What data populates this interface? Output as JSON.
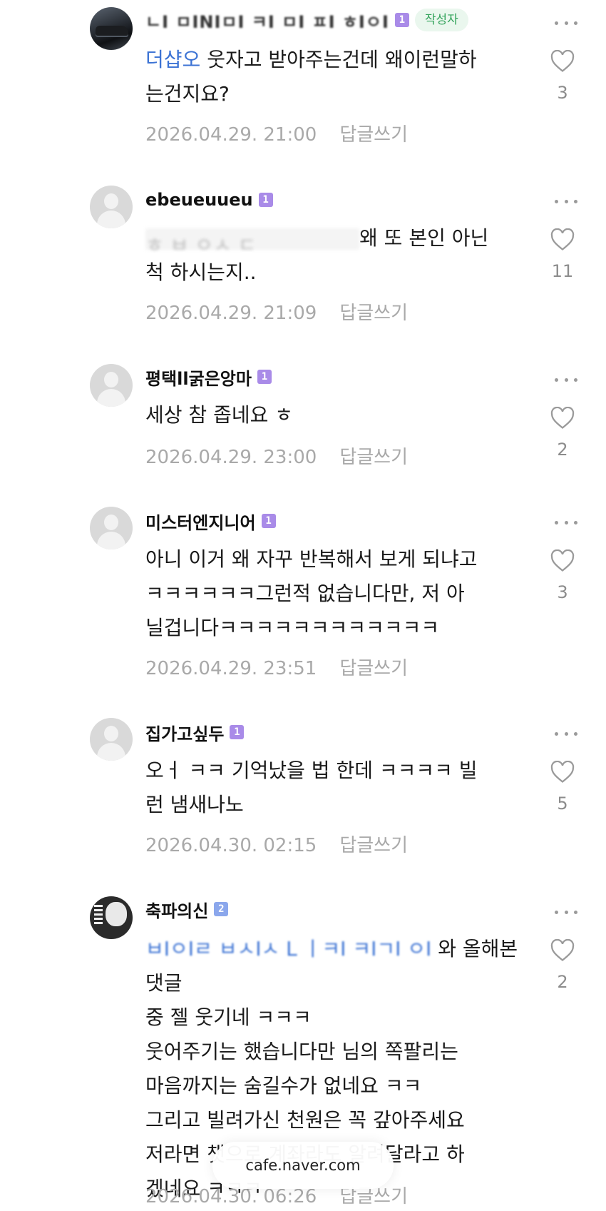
{
  "comments": [
    {
      "nickname": "ㄴI ㅁINIㅁI ㅋI ㅁI ㅍI ㅎIㅇI",
      "level": "1",
      "author_badge": "작성자",
      "mention": "더샵오",
      "lines": [
        "웃자고 받아주는건데 왜이런말하",
        "는건지요?"
      ],
      "date": "2026.04.29. 21:00",
      "reply": "답글쓰기",
      "likes": "3"
    },
    {
      "nickname": "ebeueuueu",
      "level": "1",
      "redacted_prefix": "ㅎ ㅂ ㅇㅅ ㄷ",
      "lines": [
        "왜 또 본인 아닌",
        "척 하시는지.."
      ],
      "date": "2026.04.29. 21:09",
      "reply": "답글쓰기",
      "likes": "11"
    },
    {
      "nickname": "평택ll굵은앙마",
      "level": "1",
      "lines": [
        "세상 참 좁네요 ㅎ"
      ],
      "date": "2026.04.29. 23:00",
      "reply": "답글쓰기",
      "likes": "2"
    },
    {
      "nickname": "미스터엔지니어",
      "level": "1",
      "lines": [
        "아니 이거 왜 자꾸 반복해서 보게 되냐고",
        "ㅋㅋㅋㅋㅋㅋ그런적 없습니다만, 저 아",
        "닐겁니다ㅋㅋㅋㅋㅋㅋㅋㅋㅋㅋㅋㅋ"
      ],
      "date": "2026.04.29. 23:51",
      "reply": "답글쓰기",
      "likes": "3"
    },
    {
      "nickname": "집가고싶두",
      "level": "1",
      "lines": [
        "오ㅓ ㅋㅋ 기억났을 법 한데 ㅋㅋㅋㅋ 빌",
        "런 냄새나노"
      ],
      "date": "2026.04.30. 02:15",
      "reply": "답글쓰기",
      "likes": "5"
    },
    {
      "nickname": "축파의신",
      "level": "2",
      "mention": "ㅂIㅇIㄹ ㅂㅅIㅅ L ㅣㅋI ㅋIㄱI ㅇI",
      "lines": [
        "와 올해본 댓글",
        "중 젤 웃기네 ㅋㅋㅋ",
        "웃어주기는 했습니다만 님의 쪽팔리는",
        "마음까지는 숨길수가 없네요 ㅋㅋ",
        "그리고 빌려가신 천원은 꼭 갚아주세요",
        "저라면 챗으로 계좌라도 알려달라고 하",
        "겠네요 ㅋㅋㅋ"
      ],
      "date": "2026.04.30. 06:26",
      "reply": "답글쓰기",
      "likes": "2"
    }
  ],
  "footer": {
    "domain": "cafe.naver.com"
  },
  "icons": {
    "more": "more-horizontal-icon",
    "like": "heart-outline-icon"
  },
  "colors": {
    "mention": "#3c73d4",
    "author_badge_bg": "#eaf7ee",
    "author_badge_text": "#33a35b",
    "level1": "#a98be8",
    "level2": "#8ba7ec",
    "meta": "#a9a9a9"
  }
}
